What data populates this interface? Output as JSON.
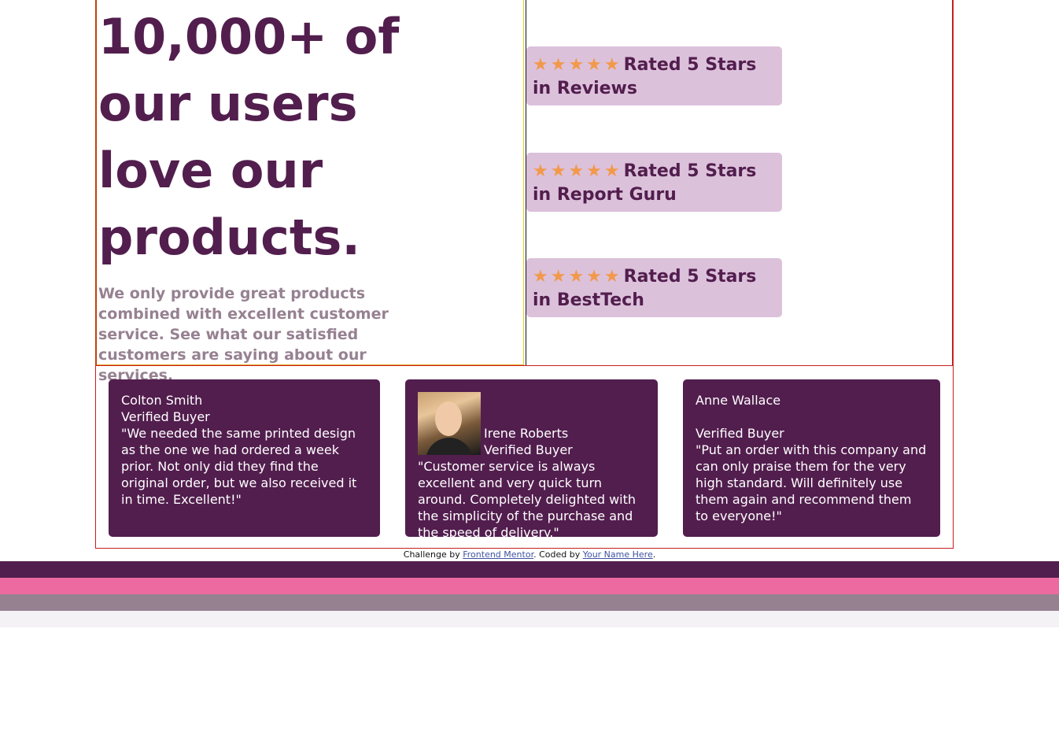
{
  "hero": {
    "headline": "10,000+ of our users love our products.",
    "intro": "We only provide great products combined with excellent customer service. See what our satisfied customers are saying about our services."
  },
  "ratings": [
    {
      "stars": "★★★★★",
      "label": "Rated 5 Stars in Reviews"
    },
    {
      "stars": "★★★★★",
      "label": "Rated 5 Stars in Report Guru"
    },
    {
      "stars": "★★★★★",
      "label": "Rated 5 Stars in BestTech"
    }
  ],
  "testimonials": [
    {
      "name": "Colton Smith",
      "status": "Verified Buyer",
      "quote": "\"We needed the same printed design as the one we had ordered a week prior. Not only did they find the original order, but we also received it in time. Excellent!\""
    },
    {
      "name": "Irene Roberts",
      "status": "Verified Buyer",
      "quote": "\"Customer service is always excellent and very quick turn around. Completely delighted with the simplicity of the purchase and the speed of delivery.\""
    },
    {
      "name": "Anne Wallace",
      "status": "Verified Buyer",
      "quote": "\"Put an order with this company and can only praise them for the very high standard. Will definitely use them again and recommend them to everyone!\""
    }
  ],
  "footer": {
    "prefix": "Challenge by ",
    "link1": "Frontend Mentor",
    "middle": ". Coded by ",
    "link2": "Your Name Here",
    "suffix": "."
  },
  "colors": {
    "primary": "#521e4e",
    "pink": "#ec6aa0",
    "greyish": "#968191",
    "light": "#f5f2f5",
    "rating_bg": "#dcc1db",
    "star": "#f2994a"
  }
}
